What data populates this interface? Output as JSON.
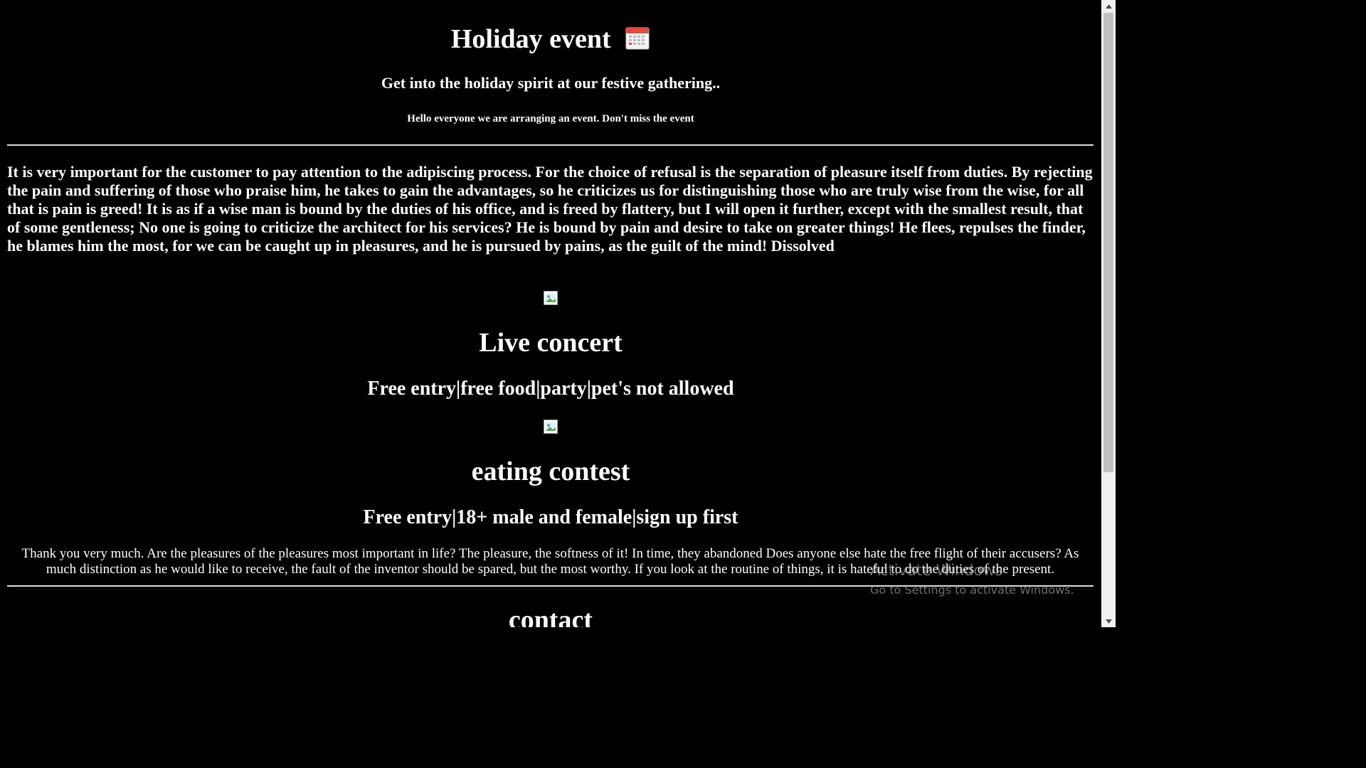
{
  "header": {
    "title": "Holiday event",
    "title_icon": "calendar-icon",
    "subtitle": "Get into the holiday spirit at our festive gathering..",
    "note": "Hello everyone we are arranging an event. Don't miss the event"
  },
  "intro": {
    "text": "It is very important for the customer to pay attention to the adipiscing process. For the choice of refusal is the separation of pleasure itself from duties. By rejecting the pain and suffering of those who praise him, he takes to gain the advantages, so he criticizes us for distinguishing those who are truly wise from the wise, for all that is pain is greed! It is as if a wise man is bound by the duties of his office, and is freed by flattery, but I will open it further, except with the smallest result, that of some gentleness; No one is going to criticize the architect for his services? He is bound by pain and desire to take on greater things! He flees, repulses the finder, he blames him the most, for we can be caught up in pleasures, and he is pursued by pains, as the guilt of the mind! Dissolved"
  },
  "events": [
    {
      "title": "Live concert",
      "details": "Free entry|free food|party|pet's not allowed"
    },
    {
      "title": "eating contest",
      "details": "Free entry|18+ male and female|sign up first"
    }
  ],
  "closing": {
    "text": "Thank you very much. Are the pleasures of the pleasures most important in life? The pleasure, the softness of it! In time, they abandoned Does anyone else hate the free flight of their accusers? As much distinction as he would like to receive, the fault of the inventor should be spared, but the most worthy. If you look at the routine of things, it is hateful to do the duties of the present."
  },
  "contact": {
    "title": "contact"
  },
  "watermark": {
    "line1": "Activate Windows",
    "line2": "Go to Settings to activate Windows."
  },
  "colors": {
    "background": "#000000",
    "text": "#ffffff",
    "rule": "#dddddd"
  }
}
